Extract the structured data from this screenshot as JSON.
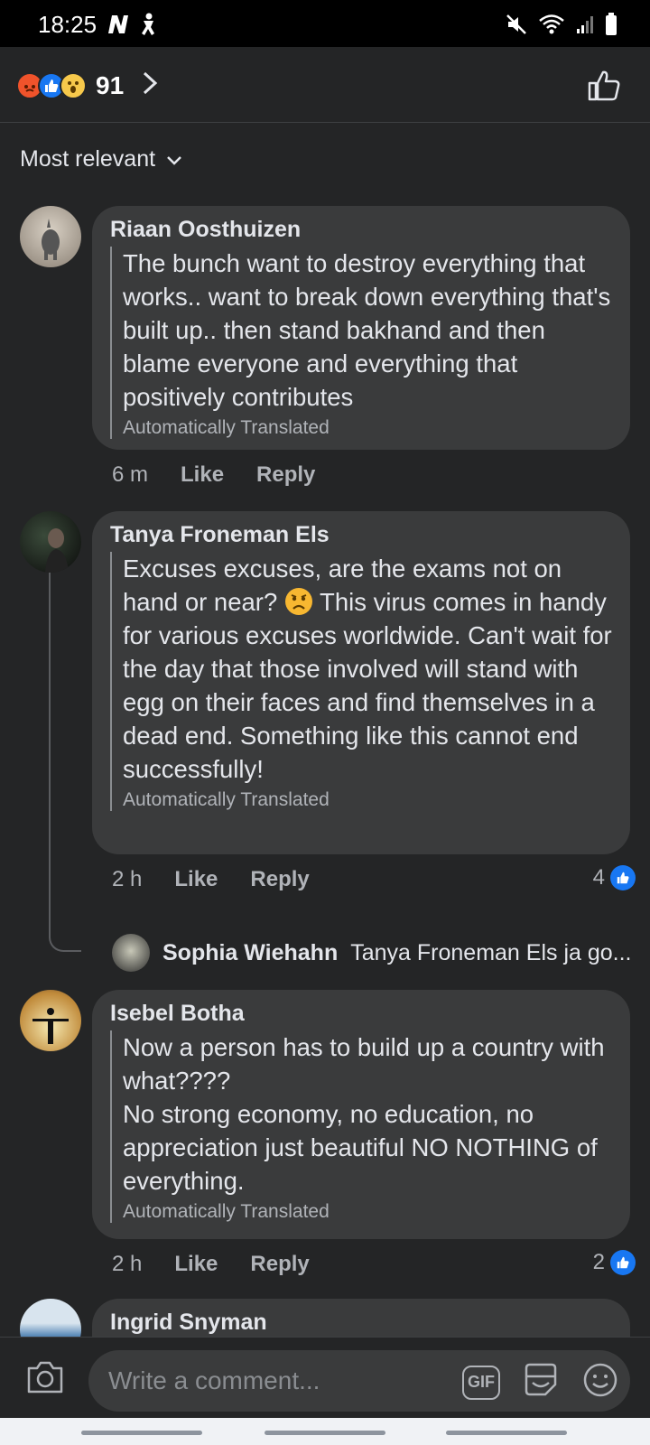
{
  "status_bar": {
    "time": "18:25"
  },
  "header": {
    "reaction_count": "91"
  },
  "sort": {
    "label": "Most relevant"
  },
  "comments": [
    {
      "name": "Riaan Oosthuizen",
      "text": "The bunch want to destroy everything that works.. want to break down everything that's built up.. then stand bakhand and then blame everyone and everything that positively contributes",
      "translated": "Automatically Translated",
      "time": "6 m",
      "like": "Like",
      "reply": "Reply"
    },
    {
      "name": "Tanya Froneman Els",
      "text_before_emoji": "Excuses excuses, are the exams not on hand or near? ",
      "text_after_emoji": " This virus comes in handy for various excuses worldwide. Can't wait for the day that those involved will stand with egg on their faces and find themselves in a dead end. Something like this cannot end successfully!",
      "translated": "Automatically Translated",
      "time": "2 h",
      "like": "Like",
      "reply": "Reply",
      "like_count": "4",
      "reply_preview": {
        "name": "Sophia Wiehahn",
        "text": "Tanya Froneman Els ja go..."
      }
    },
    {
      "name": "Isebel Botha",
      "line1": "Now a person has to build up a country with what????",
      "line2": "No strong economy, no education, no appreciation just beautiful NO NOTHING of everything.",
      "translated": "Automatically Translated",
      "time": "2 h",
      "like": "Like",
      "reply": "Reply",
      "like_count": "2"
    },
    {
      "name": "Ingrid Snyman"
    }
  ],
  "compose": {
    "placeholder": "Write a comment...",
    "gif_label": "GIF"
  },
  "colors": {
    "background": "#242526",
    "bubble": "#3a3b3c",
    "accent": "#1877f2"
  }
}
